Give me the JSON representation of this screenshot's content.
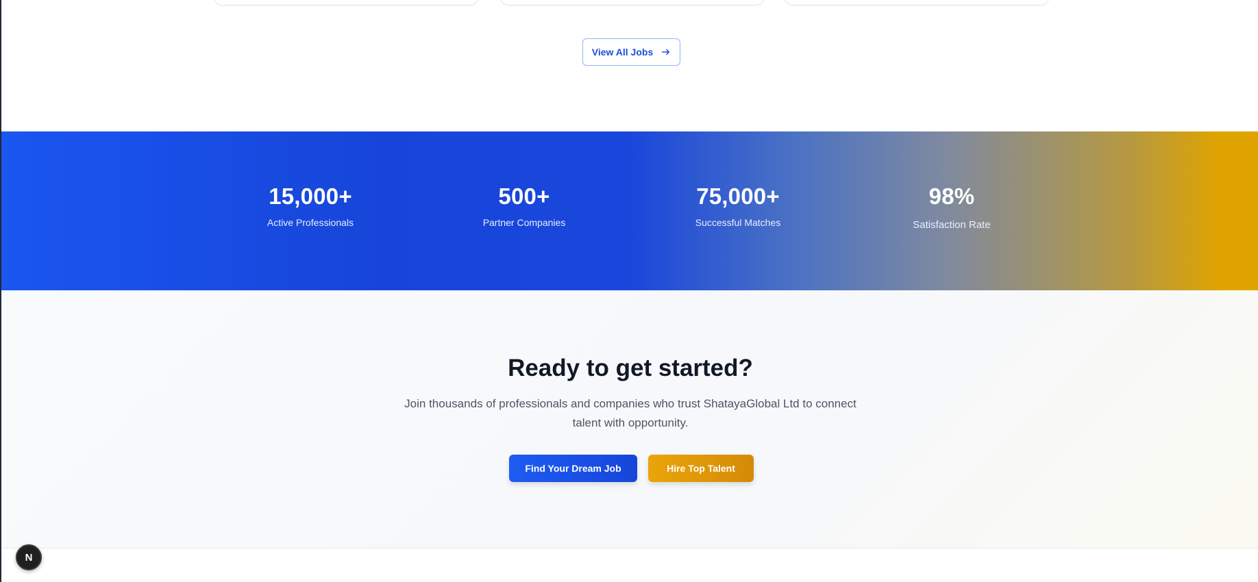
{
  "jobs": {
    "view_all_label": "View All Jobs",
    "view_all_icon": "arrow-right-icon"
  },
  "stats": [
    {
      "value": "15,000+",
      "label": "Active Professionals"
    },
    {
      "value": "500+",
      "label": "Partner Companies"
    },
    {
      "value": "75,000+",
      "label": "Successful Matches"
    },
    {
      "value": "98%",
      "label": "Satisfaction Rate"
    }
  ],
  "cta": {
    "title": "Ready to get started?",
    "description": "Join thousands of professionals and companies who trust ShatayaGlobal Ltd to connect talent with opportunity.",
    "primary_label": "Find Your Dream Job",
    "secondary_label": "Hire Top Talent"
  },
  "dev_badge": {
    "letter": "N",
    "icon": "nextjs-icon"
  },
  "colors": {
    "primary": "#1a56f0",
    "accent": "#e0a400"
  }
}
